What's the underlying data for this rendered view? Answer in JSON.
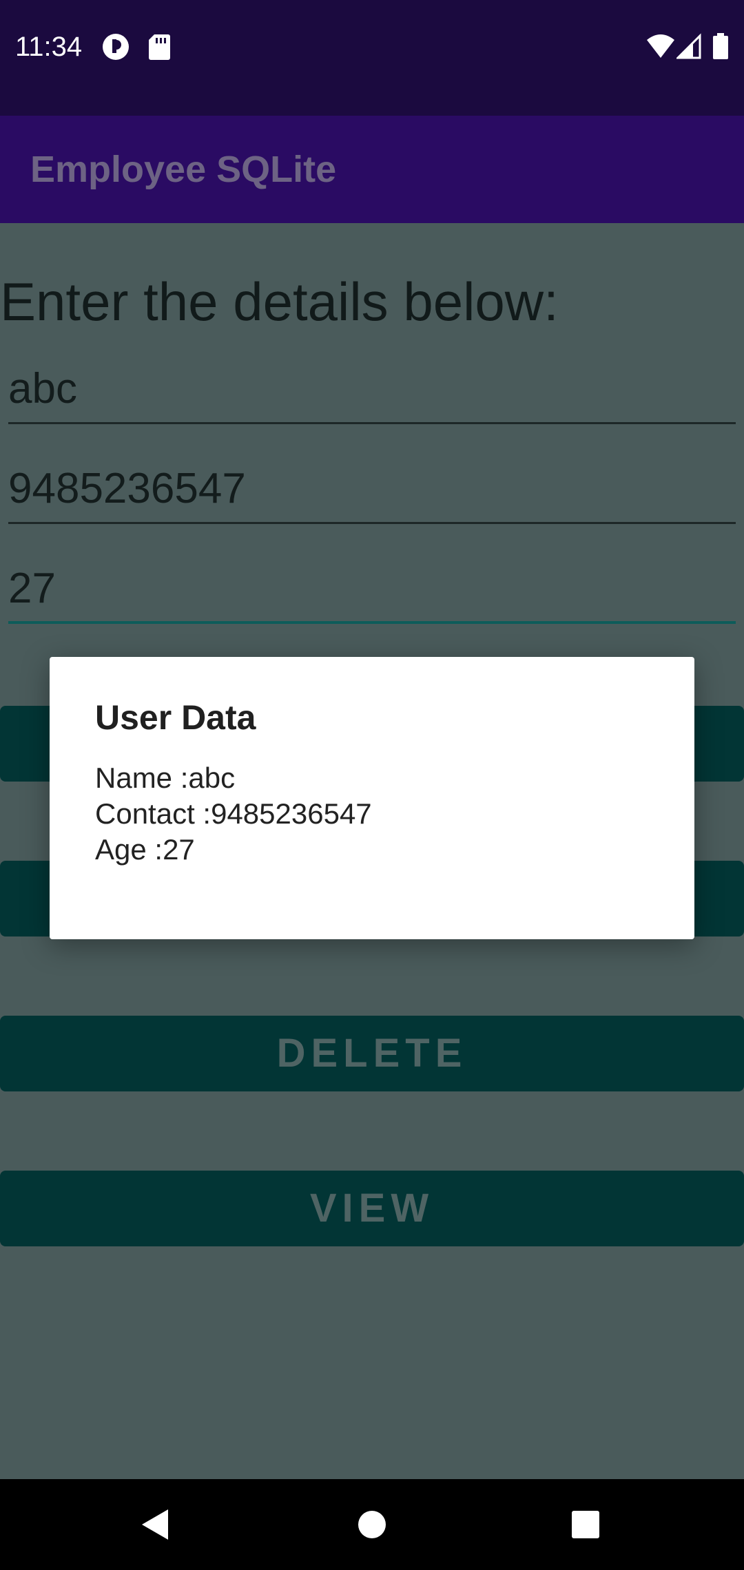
{
  "status_bar": {
    "time": "11:34",
    "icons": [
      "app-notification-icon",
      "sd-card-icon",
      "wifi-icon",
      "cellular-signal-icon",
      "battery-icon"
    ]
  },
  "app_bar": {
    "title": "Employee SQLite"
  },
  "form": {
    "heading": "Enter the details below:",
    "name_value": "abc",
    "contact_value": "9485236547",
    "age_value": "27"
  },
  "buttons": {
    "delete_label": "DELETE",
    "view_label": "VIEW"
  },
  "dialog": {
    "title": "User Data",
    "name_line": "Name :abc",
    "contact_line": "Contact :9485236547",
    "age_line": "Age :27"
  },
  "nav_bar": {
    "icons": [
      "back-icon",
      "home-icon",
      "recents-icon"
    ]
  },
  "colors": {
    "status_bar": "#1b0a3f",
    "app_bar": "#2a0b63",
    "scrim_background": "#4a5b5b",
    "button": "#023535",
    "accent_underline": "#0d5c5a"
  }
}
